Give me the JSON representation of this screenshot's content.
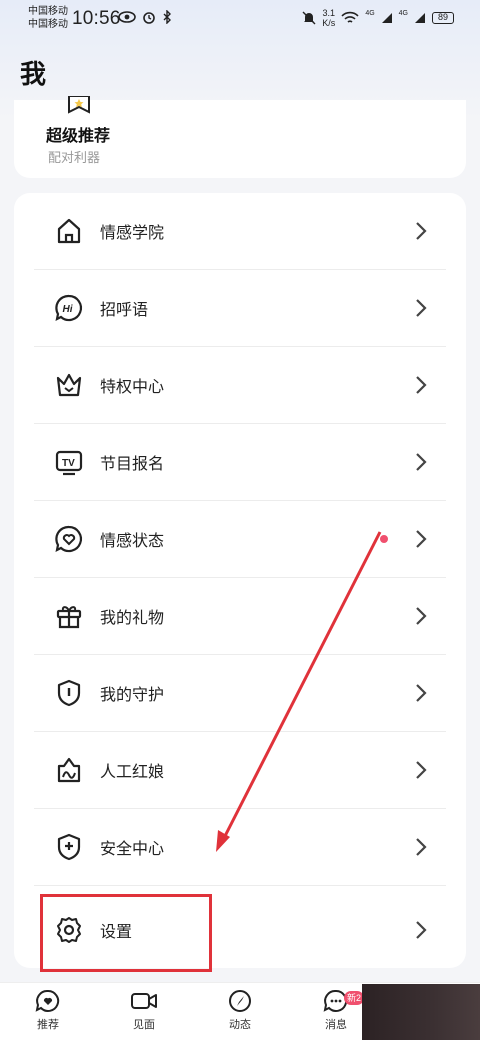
{
  "status_bar": {
    "carrier1": "中国移动",
    "carrier2": "中国移动",
    "time": "10:56",
    "net_speed_value": "3.1",
    "net_speed_unit": "K/s",
    "signal1": "4G",
    "signal2": "4G",
    "battery": "89"
  },
  "page": {
    "title": "我"
  },
  "recommend": {
    "title": "超级推荐",
    "subtitle": "配对利器"
  },
  "menu": {
    "items": [
      {
        "label": "情感学院",
        "icon": "house-icon"
      },
      {
        "label": "招呼语",
        "icon": "hi-bubble-icon"
      },
      {
        "label": "特权中心",
        "icon": "crown-icon"
      },
      {
        "label": "节目报名",
        "icon": "tv-icon"
      },
      {
        "label": "情感状态",
        "icon": "heart-bubble-icon"
      },
      {
        "label": "我的礼物",
        "icon": "gift-icon"
      },
      {
        "label": "我的守护",
        "icon": "guard-shield-icon"
      },
      {
        "label": "人工红娘",
        "icon": "matchmaker-icon"
      },
      {
        "label": "安全中心",
        "icon": "shield-plus-icon"
      },
      {
        "label": "设置",
        "icon": "gear-icon"
      }
    ]
  },
  "tabbar": {
    "tabs": [
      {
        "label": "推荐",
        "icon": "recommend-heart-icon"
      },
      {
        "label": "见面",
        "icon": "video-camera-icon"
      },
      {
        "label": "动态",
        "icon": "compass-icon"
      },
      {
        "label": "消息",
        "icon": "chat-bubble-icon"
      }
    ],
    "message_badge": "新2"
  },
  "colors": {
    "accent_red": "#f0506e",
    "annotation_red": "#e0323a",
    "background": "#f4f5f8"
  }
}
